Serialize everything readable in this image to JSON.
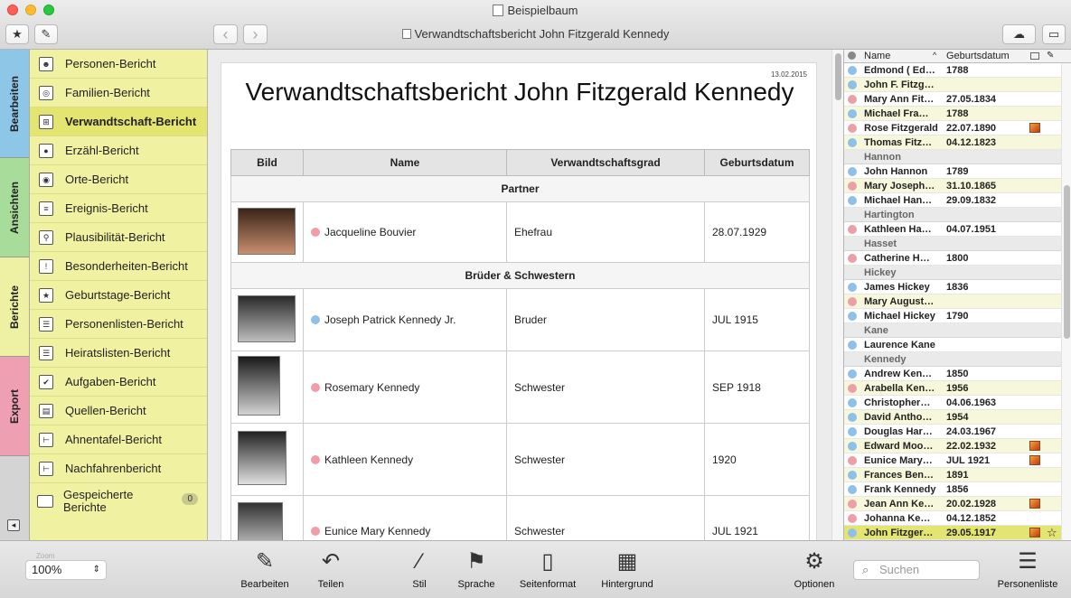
{
  "window": {
    "title": "Beispielbaum",
    "document_title": "Verwandtschaftsbericht John Fitzgerald Kennedy",
    "toolbar": {
      "star_icon": "★",
      "tag_icon": "✎",
      "back_icon": "‹",
      "forward_icon": "›",
      "cloud_icon": "☁",
      "layout_icon": "▭"
    }
  },
  "tabs": [
    "Bearbeiten",
    "Ansichten",
    "Berichte",
    "Export"
  ],
  "sidebar": {
    "items": [
      {
        "label": "Personen-Bericht",
        "icon": "☻"
      },
      {
        "label": "Familien-Bericht",
        "icon": "◎"
      },
      {
        "label": "Verwandtschaft-Bericht",
        "icon": "⊞",
        "active": true
      },
      {
        "label": "Erzähl-Bericht",
        "icon": "●"
      },
      {
        "label": "Orte-Bericht",
        "icon": "◉"
      },
      {
        "label": "Ereignis-Bericht",
        "icon": "≡"
      },
      {
        "label": "Plausibilität-Bericht",
        "icon": "⚲"
      },
      {
        "label": "Besonderheiten-Bericht",
        "icon": "!"
      },
      {
        "label": "Geburtstage-Bericht",
        "icon": "★"
      },
      {
        "label": "Personenlisten-Bericht",
        "icon": "☰"
      },
      {
        "label": "Heiratslisten-Bericht",
        "icon": "☰"
      },
      {
        "label": "Aufgaben-Bericht",
        "icon": "✔"
      },
      {
        "label": "Quellen-Bericht",
        "icon": "▤"
      },
      {
        "label": "Ahnentafel-Bericht",
        "icon": "⊢"
      },
      {
        "label": "Nachfahrenbericht",
        "icon": "⊢"
      }
    ],
    "saved": {
      "label_line1": "Gespeicherte",
      "label_line2": "Berichte",
      "count": "0"
    },
    "collapse_icon": "◂"
  },
  "report": {
    "date": "13.02.2015",
    "title": "Verwandtschaftsbericht John Fitzgerald Kennedy",
    "columns": [
      "Bild",
      "Name",
      "Verwandtschaftsgrad",
      "Geburtsdatum"
    ],
    "sections": [
      {
        "title": "Partner",
        "rows": [
          {
            "name": "Jacqueline Bouvier",
            "gender": "f",
            "relation": "Ehefrau",
            "birth": "28.07.1929"
          }
        ]
      },
      {
        "title": "Brüder & Schwestern",
        "rows": [
          {
            "name": "Joseph Patrick Kennedy Jr.",
            "gender": "m",
            "relation": "Bruder",
            "birth": "JUL 1915"
          },
          {
            "name": "Rosemary Kennedy",
            "gender": "f",
            "relation": "Schwester",
            "birth": "SEP 1918"
          },
          {
            "name": "Kathleen Kennedy",
            "gender": "f",
            "relation": "Schwester",
            "birth": "1920"
          },
          {
            "name": "Eunice Mary Kennedy",
            "gender": "f",
            "relation": "Schwester",
            "birth": "JUL 1921"
          }
        ]
      }
    ]
  },
  "person_list": {
    "columns": {
      "name": "Name",
      "birth": "Geburtsdatum"
    },
    "entries": [
      {
        "name": "Edmond ( Ed…",
        "birth": "1788",
        "g": "m"
      },
      {
        "name": "John F. Fitzg…",
        "birth": "",
        "g": "m"
      },
      {
        "name": "Mary Ann Fit…",
        "birth": "27.05.1834",
        "g": "f"
      },
      {
        "name": "Michael Fra…",
        "birth": "1788",
        "g": "m"
      },
      {
        "name": "Rose Fitzgerald",
        "birth": "22.07.1890",
        "g": "f",
        "img": true
      },
      {
        "name": "Thomas Fitz…",
        "birth": "04.12.1823",
        "g": "m"
      },
      {
        "group": "Hannon"
      },
      {
        "name": "John Hannon",
        "birth": "1789",
        "g": "m"
      },
      {
        "name": "Mary Joseph…",
        "birth": "31.10.1865",
        "g": "f"
      },
      {
        "name": "Michael Han…",
        "birth": "29.09.1832",
        "g": "m"
      },
      {
        "group": "Hartington"
      },
      {
        "name": "Kathleen Ha…",
        "birth": "04.07.1951",
        "g": "f"
      },
      {
        "group": "Hasset"
      },
      {
        "name": "Catherine H…",
        "birth": "1800",
        "g": "f"
      },
      {
        "group": "Hickey"
      },
      {
        "name": "James Hickey",
        "birth": "1836",
        "g": "m"
      },
      {
        "name": "Mary August…",
        "birth": "",
        "g": "f"
      },
      {
        "name": "Michael Hickey",
        "birth": "1790",
        "g": "m"
      },
      {
        "group": "Kane"
      },
      {
        "name": "Laurence Kane",
        "birth": "",
        "g": "m"
      },
      {
        "group": "Kennedy"
      },
      {
        "name": "Andrew Ken…",
        "birth": "1850",
        "g": "m"
      },
      {
        "name": "Arabella Ken…",
        "birth": "1956",
        "g": "f"
      },
      {
        "name": "Christopher…",
        "birth": "04.06.1963",
        "g": "m"
      },
      {
        "name": "David Antho…",
        "birth": "1954",
        "g": "m"
      },
      {
        "name": "Douglas Har…",
        "birth": "24.03.1967",
        "g": "m"
      },
      {
        "name": "Edward Moo…",
        "birth": "22.02.1932",
        "g": "m",
        "img": true
      },
      {
        "name": "Eunice Mary…",
        "birth": "JUL 1921",
        "g": "f",
        "img": true
      },
      {
        "name": "Frances Ben…",
        "birth": "1891",
        "g": "m"
      },
      {
        "name": "Frank Kennedy",
        "birth": "1856",
        "g": "m"
      },
      {
        "name": "Jean Ann Ke…",
        "birth": "20.02.1928",
        "g": "f",
        "img": true
      },
      {
        "name": "Johanna Ke…",
        "birth": "04.12.1852",
        "g": "f"
      },
      {
        "name": "John Fitzger…",
        "birth": "29.05.1917",
        "g": "m",
        "img": true,
        "star": true,
        "selected": true
      }
    ]
  },
  "bottom": {
    "zoom_label": "Zoom",
    "zoom": "100%",
    "tools": [
      {
        "label": "Bearbeiten",
        "icon": "✎"
      },
      {
        "label": "Teilen",
        "icon": "↶"
      },
      {
        "label": "Stil",
        "icon": "⁄"
      },
      {
        "label": "Sprache",
        "icon": "⚑"
      },
      {
        "label": "Seitenformat",
        "icon": "▯"
      },
      {
        "label": "Hintergrund",
        "icon": "▦"
      }
    ],
    "options_label": "Optionen",
    "options_icon": "⚙",
    "search_placeholder": "Suchen",
    "person_list_label": "Personenliste",
    "person_list_icon": "☰"
  },
  "colors": {
    "female": "#ef9ea8",
    "male": "#8dc0ea",
    "sidebar": "#f1f2a1",
    "tab_edit": "#8ec6e8",
    "tab_views": "#a7dc9a",
    "tab_reports": "#eef0a4",
    "tab_export": "#ef9fb2"
  }
}
